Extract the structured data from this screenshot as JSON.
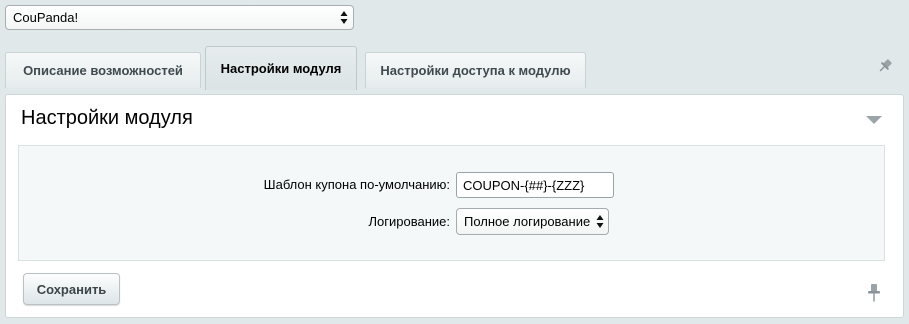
{
  "module_select": {
    "value": "CouPanda!"
  },
  "tabs": [
    {
      "label": "Описание возможностей",
      "active": false
    },
    {
      "label": "Настройки модуля",
      "active": true
    },
    {
      "label": "Настройки доступа к модулю",
      "active": false
    }
  ],
  "panel": {
    "title": "Настройки модуля",
    "fields": {
      "coupon_template": {
        "label": "Шаблон купона по-умолчанию:",
        "value": "COUPON-{##}-{ZZZ}"
      },
      "logging": {
        "label": "Логирование:",
        "value": "Полное логирование"
      }
    },
    "save_label": "Сохранить"
  },
  "icons": {
    "tab_pin": "pushpin-icon",
    "collapse": "triangle-down-icon",
    "bottom_pin": "pin-icon",
    "select_arrows": "updown-arrows-icon"
  },
  "colors": {
    "background": "#e1e8ea",
    "active_tab": "#dbe3e5",
    "settings_area": "#f4f8f9"
  }
}
